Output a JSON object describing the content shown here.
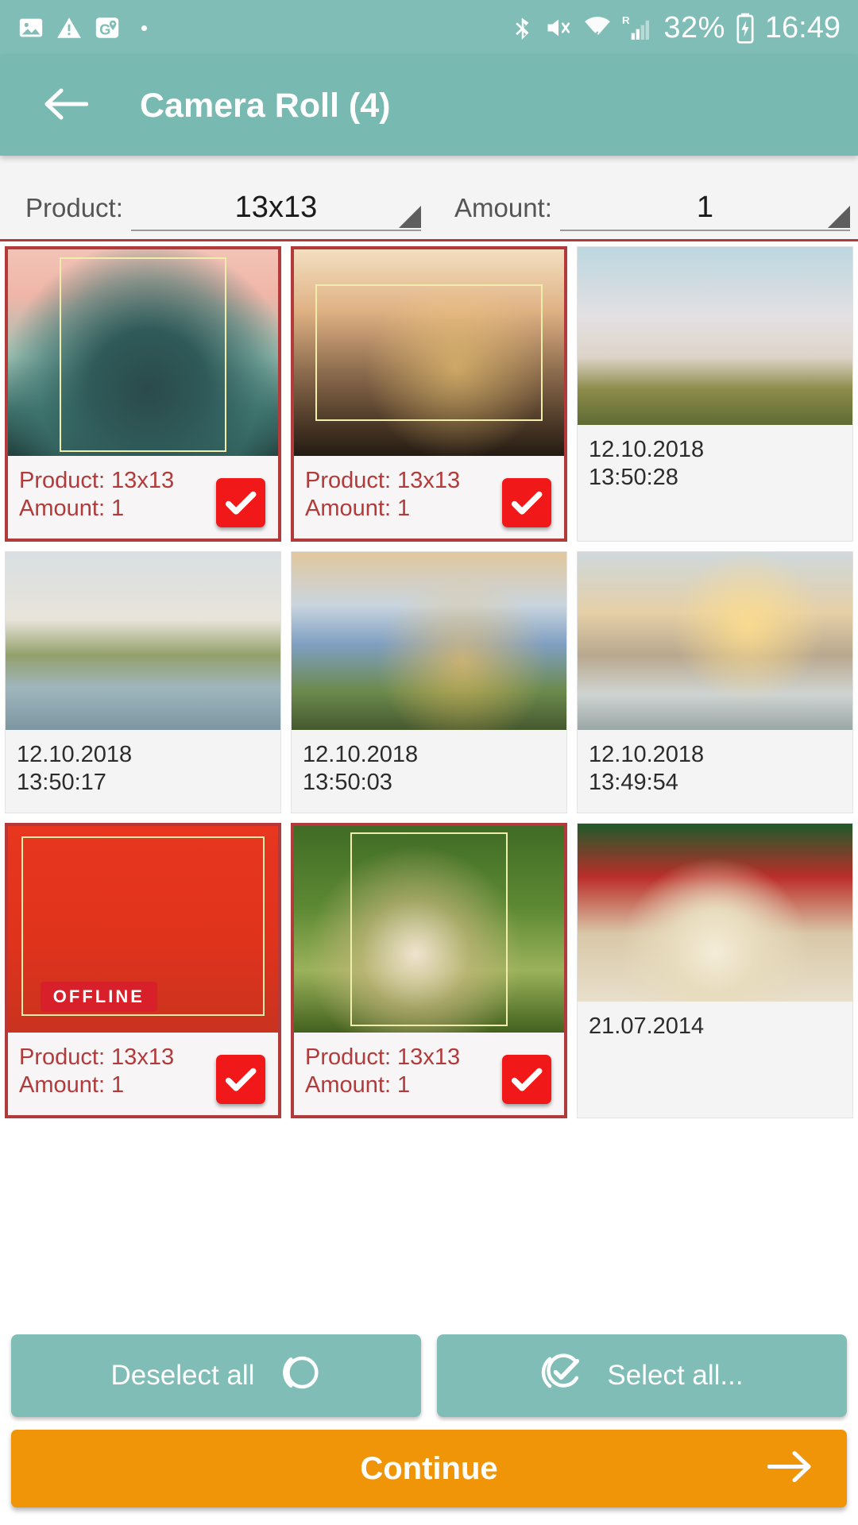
{
  "statusbar": {
    "icons_left": [
      "image-icon",
      "warning-icon",
      "maps-icon"
    ],
    "icons_right": [
      "bluetooth-icon",
      "vibrate-mute-icon",
      "wifi-icon",
      "signal-roaming-icon",
      "battery-charging-icon"
    ],
    "battery_percent": "32%",
    "clock": "16:49"
  },
  "appbar": {
    "back_icon": "arrow-left-icon",
    "title": "Camera Roll (4)",
    "color": "#78b9b2"
  },
  "selector": {
    "product_label": "Product:",
    "product_value": "13x13",
    "amount_label": "Amount:",
    "amount_value": "1",
    "divider_color": "#b33a3a"
  },
  "grid": {
    "cells": [
      {
        "selected": true,
        "art": "p-smoke",
        "product_line": "Product: 13x13",
        "amount_line": "Amount: 1",
        "badge": "check-badge"
      },
      {
        "selected": true,
        "art": "p-polaroid",
        "product_line": "Product: 13x13",
        "amount_line": "Amount: 1",
        "badge": "check-badge"
      },
      {
        "selected": false,
        "art": "p-jump",
        "date": "12.10.2018",
        "time": "13:50:28"
      },
      {
        "selected": false,
        "art": "p-car",
        "date": "12.10.2018",
        "time": "13:50:17"
      },
      {
        "selected": false,
        "art": "p-piggy",
        "date": "12.10.2018",
        "time": "13:50:03"
      },
      {
        "selected": false,
        "art": "p-sunset",
        "date": "12.10.2018",
        "time": "13:49:54"
      },
      {
        "selected": true,
        "art": "p-red",
        "product_line": "Product: 13x13",
        "amount_line": "Amount: 1",
        "badge": "check-badge",
        "overlay_text": "OFFLINE"
      },
      {
        "selected": true,
        "art": "p-green",
        "product_line": "Product: 13x13",
        "amount_line": "Amount: 1",
        "badge": "check-badge"
      },
      {
        "selected": false,
        "art": "p-cake",
        "date": "21.07.2014",
        "time": ""
      }
    ]
  },
  "actions": {
    "deselect_label": "Deselect all",
    "deselect_icon": "circle-outline-icon",
    "select_label": "Select all...",
    "select_icon": "check-circle-icon",
    "button_color": "#80bdb6"
  },
  "continue": {
    "label": "Continue",
    "icon": "arrow-right-icon",
    "color": "#f09508"
  }
}
